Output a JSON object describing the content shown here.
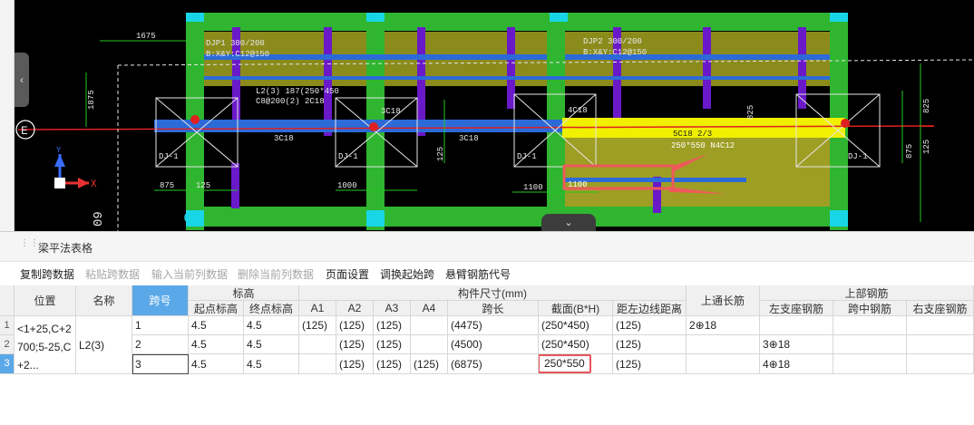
{
  "cad": {
    "dims": [
      "1675",
      "1875",
      "875",
      "125",
      "1000",
      "1100",
      "1100",
      "125",
      "875",
      "825",
      "825",
      "125",
      "09"
    ],
    "axis_label": "E",
    "ucs": {
      "x": "X",
      "y": "Y"
    },
    "labels": [
      "DJP1 300/200",
      "B:X&Y:C12@150",
      "DJP2 300/200",
      "B:X&Y:C12@150",
      "L2(3) 187(250*450",
      "C8@200(2) 2C18",
      "3C18",
      "3C18",
      "3C18",
      "4C18",
      "5C18 2/3",
      "250*550 N4C12",
      "DJ-1",
      "DJ-1",
      "DJ-1",
      "DJ-1",
      "1100"
    ]
  },
  "panel": {
    "title": "梁平法表格",
    "toolbar": [
      {
        "label": "复制跨数据",
        "enabled": true
      },
      {
        "label": "粘贴跨数据",
        "enabled": false
      },
      {
        "label": "输入当前列数据",
        "enabled": false
      },
      {
        "label": "删除当前列数据",
        "enabled": false
      },
      {
        "label": "页面设置",
        "enabled": true
      },
      {
        "label": "调换起始跨",
        "enabled": true
      },
      {
        "label": "悬臂钢筋代号",
        "enabled": true
      }
    ]
  },
  "table": {
    "headers": {
      "position": "位置",
      "name": "名称",
      "span_no": "跨号",
      "elevation": "标高",
      "start_elev": "起点标高",
      "end_elev": "终点标高",
      "dims": "构件尺寸(mm)",
      "a1": "A1",
      "a2": "A2",
      "a3": "A3",
      "a4": "A4",
      "span_len": "跨长",
      "section": "截面(B*H)",
      "offset": "距左边线距离",
      "top_through": "上通长筋",
      "top_rebar": "上部钢筋",
      "left_support": "左支座钢筋",
      "mid_span": "跨中钢筋",
      "right_support": "右支座钢筋"
    },
    "position_text": "<1+25,C+2700;5-25,C+2...",
    "name_text": "L2(3)",
    "rows": [
      {
        "no": "1",
        "span": "1",
        "start": "4.5",
        "end": "4.5",
        "a1": "(125)",
        "a2": "(125)",
        "a3": "(125)",
        "a4": "",
        "len": "(4475)",
        "sec": "(250*450)",
        "off": "(125)",
        "top_through": "2⊕18",
        "left": "",
        "mid": "",
        "right": ""
      },
      {
        "no": "2",
        "span": "2",
        "start": "4.5",
        "end": "4.5",
        "a1": "",
        "a2": "(125)",
        "a3": "(125)",
        "a4": "",
        "len": "(4500)",
        "sec": "(250*450)",
        "off": "(125)",
        "top_through": "",
        "left": "3⊕18",
        "mid": "",
        "right": ""
      },
      {
        "no": "3",
        "span": "3",
        "start": "4.5",
        "end": "4.5",
        "a1": "",
        "a2": "(125)",
        "a3": "(125)",
        "a4": "(125)",
        "len": "(6875)",
        "sec": "250*550",
        "off": "(125)",
        "top_through": "",
        "left": "4⊕18",
        "mid": "",
        "right": ""
      }
    ]
  }
}
